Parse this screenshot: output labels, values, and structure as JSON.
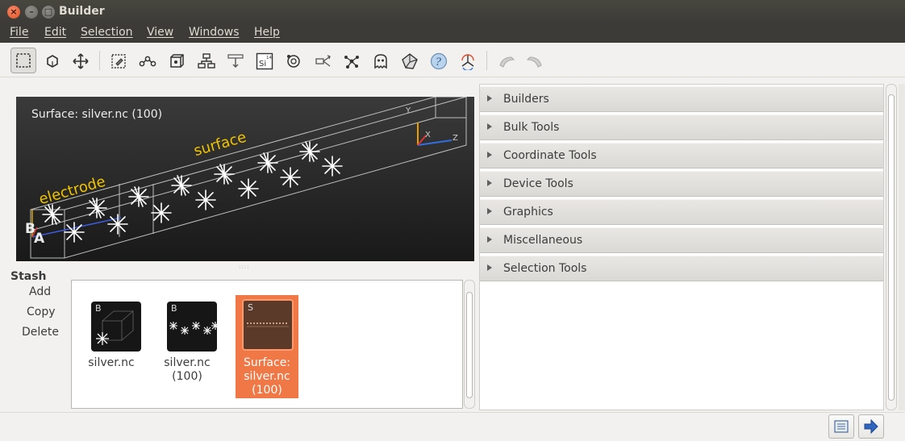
{
  "window": {
    "title": "Builder"
  },
  "menubar": {
    "items": [
      {
        "label": "File"
      },
      {
        "label": "Edit"
      },
      {
        "label": "Selection"
      },
      {
        "label": "View"
      },
      {
        "label": "Windows"
      },
      {
        "label": "Help"
      }
    ]
  },
  "toolbar": {
    "tools": [
      {
        "icon": "select-region-icon",
        "active": true
      },
      {
        "icon": "rotate-icon"
      },
      {
        "icon": "move-icon"
      },
      {
        "icon": "select-tool-icon"
      },
      {
        "icon": "bonds-icon"
      },
      {
        "icon": "cell-icon"
      },
      {
        "icon": "hierarchy-icon"
      },
      {
        "icon": "measure-icon"
      },
      {
        "icon": "element-si-icon",
        "element_symbol": "Si",
        "element_number": "14"
      },
      {
        "icon": "atom-label-icon"
      },
      {
        "icon": "split-icon"
      },
      {
        "icon": "molecule-icon"
      },
      {
        "icon": "ghost-icon"
      },
      {
        "icon": "polyhedra-icon"
      },
      {
        "icon": "help-icon"
      },
      {
        "icon": "axes-icon"
      },
      {
        "icon": "undo-icon"
      },
      {
        "icon": "redo-icon"
      }
    ]
  },
  "viewport": {
    "label": "Surface: silver.nc (100)",
    "electrode_label": "electrode",
    "surface_label": "surface",
    "axis_y": "Y",
    "axis_x": "X",
    "axis_z": "Z",
    "corner_b": "B",
    "corner_a": "A"
  },
  "stash": {
    "title": "Stash",
    "add_label": "Add",
    "copy_label": "Copy",
    "delete_label": "Delete",
    "items": [
      {
        "letter": "B",
        "label": "silver.nc",
        "selected": false
      },
      {
        "letter": "B",
        "label": "silver.nc (100)",
        "selected": false
      },
      {
        "letter": "S",
        "label": "Surface: silver.nc (100)",
        "selected": true
      }
    ]
  },
  "panels": {
    "sections": [
      {
        "label": "Builders"
      },
      {
        "label": "Bulk Tools"
      },
      {
        "label": "Coordinate Tools"
      },
      {
        "label": "Device Tools"
      },
      {
        "label": "Graphics"
      },
      {
        "label": "Miscellaneous"
      },
      {
        "label": "Selection Tools"
      }
    ]
  },
  "bottombar": {
    "buttons": [
      {
        "icon": "panel-icon"
      },
      {
        "icon": "send-arrow-icon"
      }
    ]
  },
  "colors": {
    "accent": "#f07746",
    "highlight_text": "#f2c400",
    "titlebar": "#3c3b37"
  }
}
